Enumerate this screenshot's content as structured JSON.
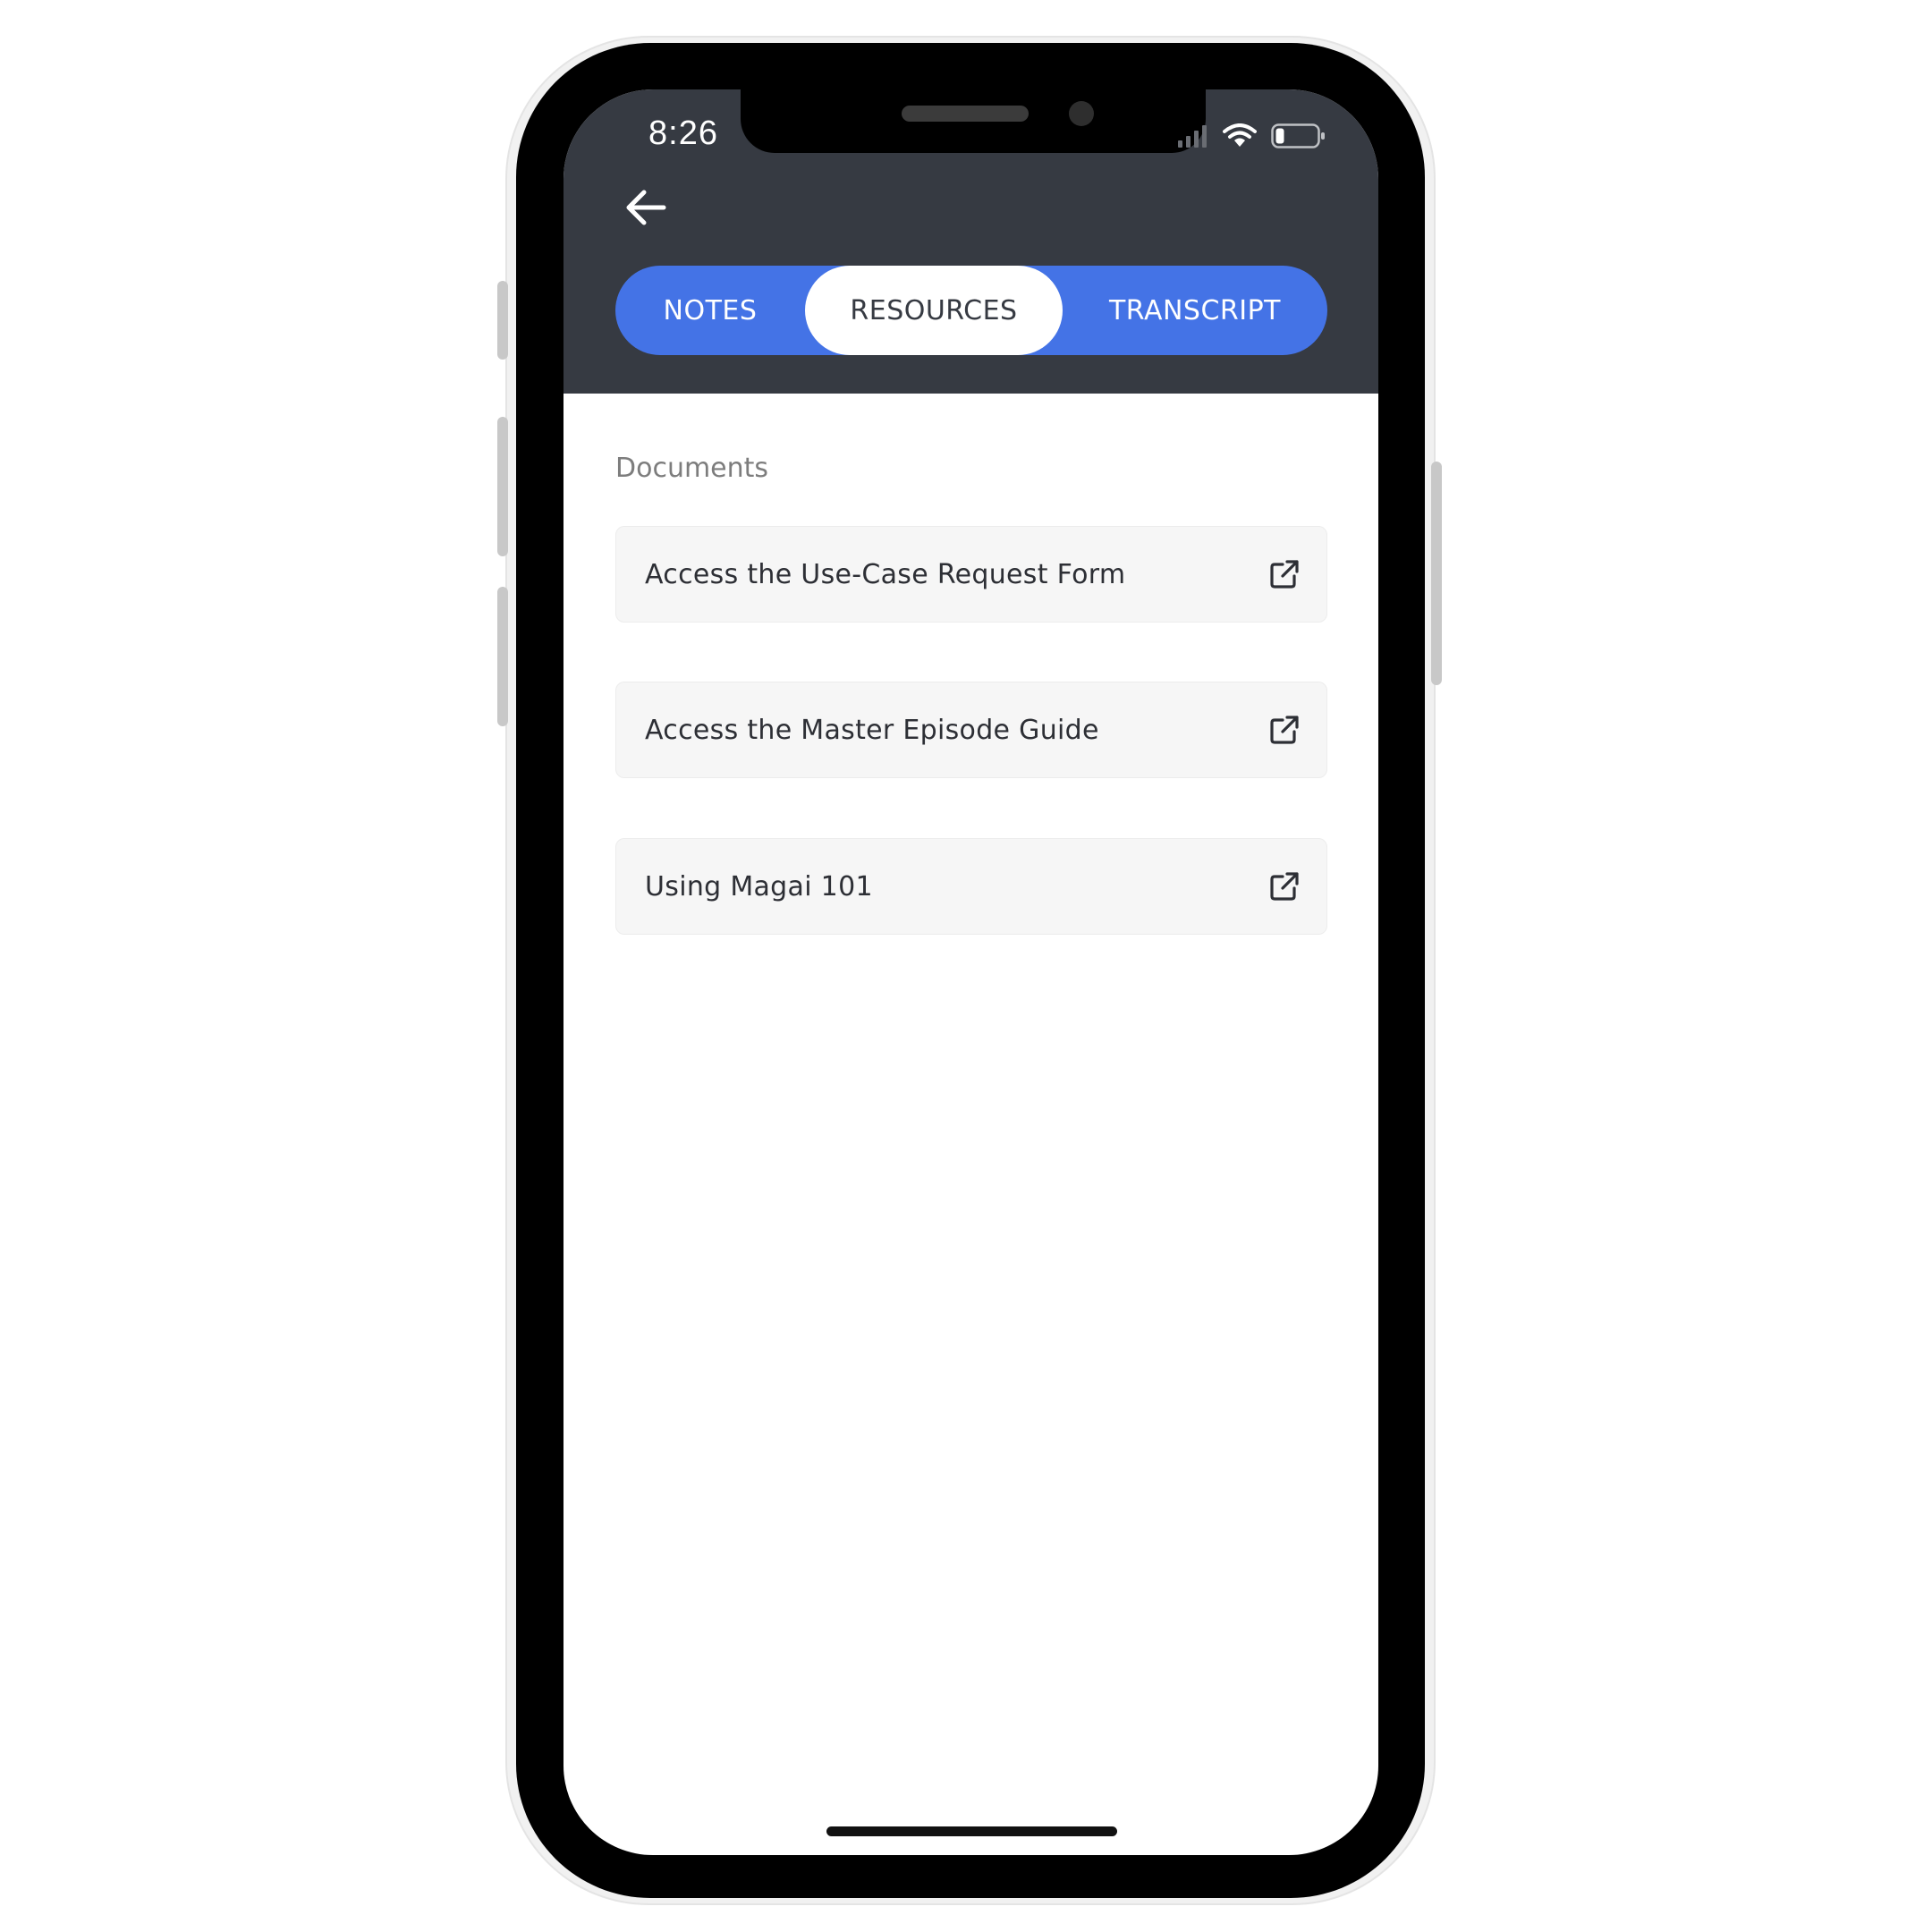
{
  "status_bar": {
    "time": "8:26"
  },
  "header": {
    "background_color": "#363a42",
    "back_icon": "arrow-left-icon"
  },
  "tabs": {
    "accent_color": "#4473e6",
    "items": [
      {
        "label": "NOTES",
        "selected": false
      },
      {
        "label": "RESOURCES",
        "selected": true
      },
      {
        "label": "TRANSCRIPT",
        "selected": false
      }
    ]
  },
  "documents": {
    "section_title": "Documents",
    "items": [
      {
        "label": "Access the Use-Case Request Form",
        "icon": "external-link-icon"
      },
      {
        "label": "Access the Master Episode Guide",
        "icon": "external-link-icon"
      },
      {
        "label": "Using Magai 101",
        "icon": "external-link-icon"
      }
    ]
  }
}
